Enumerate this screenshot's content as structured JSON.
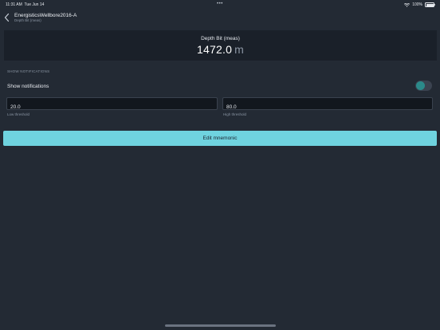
{
  "status_bar": {
    "time": "11:31 AM",
    "date": "Tue Jun 14",
    "dots": "•••",
    "battery_percent": "100%"
  },
  "nav": {
    "title": "EnergisticsWellbore2016-A",
    "subtitle": "Depth Bit (meas)"
  },
  "value_card": {
    "label": "Depth Bit (meas)",
    "value": "1472.0",
    "unit": "m"
  },
  "notifications": {
    "section_header": "SHOW NOTIFICATIONS",
    "toggle_label": "Show notifications",
    "enabled": true,
    "low_threshold_value": "20.0",
    "low_threshold_label": "Low threshold",
    "high_threshold_value": "80.0",
    "high_threshold_label": "High threshold"
  },
  "actions": {
    "edit_mnemonic_label": "Edit mnemonic"
  },
  "colors": {
    "background": "#232a34",
    "card": "#1a2029",
    "accent": "#6fd3df",
    "toggle_knob": "#2b8a8a"
  }
}
